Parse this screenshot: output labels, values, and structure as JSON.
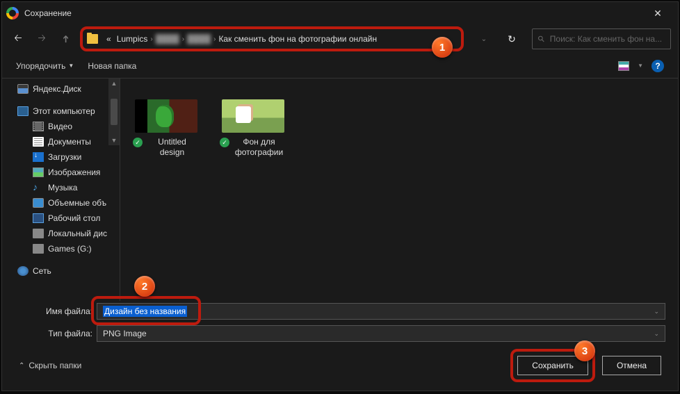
{
  "window": {
    "title": "Сохранение"
  },
  "breadcrumb": {
    "prefix": "«",
    "items": [
      "Lumpics",
      "████",
      "████",
      "Как сменить фон на фотографии онлайн"
    ]
  },
  "search": {
    "placeholder": "Поиск: Как сменить фон на..."
  },
  "toolbar": {
    "organize": "Упорядочить",
    "newfolder": "Новая папка"
  },
  "tree": {
    "yandex": "Яндекс.Диск",
    "pc": "Этот компьютер",
    "video": "Видео",
    "docs": "Документы",
    "downloads": "Загрузки",
    "images": "Изображения",
    "music": "Музыка",
    "objects3d": "Объемные объ",
    "desktop": "Рабочий стол",
    "localdisk": "Локальный дис",
    "games": "Games (G:)",
    "network": "Сеть"
  },
  "files": [
    {
      "name": "Untitled design"
    },
    {
      "name": "Фон для фотографии"
    }
  ],
  "form": {
    "name_label": "Имя файла:",
    "name_value": "Дизайн без названия",
    "type_label": "Тип файла:",
    "type_value": "PNG Image"
  },
  "actions": {
    "hide": "Скрыть папки",
    "save": "Сохранить",
    "cancel": "Отмена"
  },
  "badges": {
    "b1": "1",
    "b2": "2",
    "b3": "3"
  }
}
